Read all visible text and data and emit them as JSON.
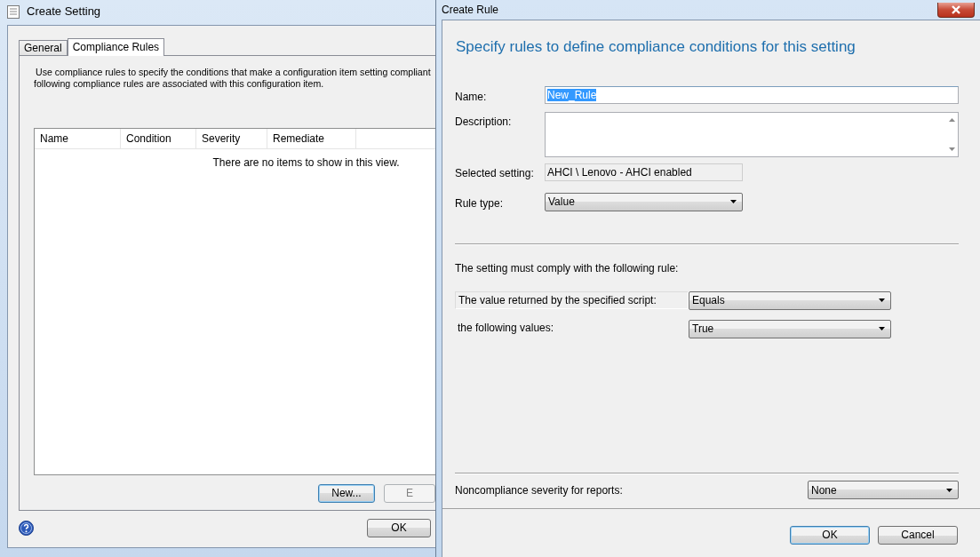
{
  "create_setting": {
    "title": "Create Setting",
    "tabs": [
      {
        "label": "General",
        "selected": false
      },
      {
        "label": "Compliance Rules",
        "selected": true
      }
    ],
    "intro_lines": [
      "Use compliance rules to specify the conditions that make a configuration item setting compliant",
      "following compliance rules are associated with this configuration item."
    ],
    "table": {
      "columns": [
        "Name",
        "Condition",
        "Severity",
        "Remediate"
      ],
      "empty_message": "There are no items to show in this view."
    },
    "buttons": [
      {
        "label": "New...",
        "disabled": false,
        "default": true
      },
      {
        "label": "E",
        "disabled": true,
        "default": false
      }
    ],
    "footer_buttons": [
      {
        "label": "OK",
        "disabled": false,
        "default": false
      }
    ]
  },
  "create_rule": {
    "title": "Create Rule",
    "heading": "Specify rules to define compliance conditions for this setting",
    "fields": [
      {
        "kind": "text",
        "label": "Name:",
        "value": "New_Rule",
        "text_selected": true
      },
      {
        "kind": "textarea",
        "label": "Description:"
      },
      {
        "kind": "readonly",
        "label": "Selected setting:",
        "value": "AHCI \\ Lenovo - AHCI enabled"
      },
      {
        "kind": "dropdown",
        "label": "Rule type:",
        "value": "Value"
      }
    ],
    "rule_intro": "The setting must comply with the following rule:",
    "conditions": [
      {
        "kind": "boxed",
        "label": "The value returned by the specified script:",
        "value": "Equals"
      },
      {
        "kind": "plain",
        "label": "the following values:",
        "value": "True"
      }
    ],
    "severity": {
      "label": "Noncompliance severity for reports:",
      "value": "None"
    },
    "buttons": [
      {
        "label": "OK",
        "default": true
      },
      {
        "label": "Cancel",
        "default": false
      }
    ]
  }
}
